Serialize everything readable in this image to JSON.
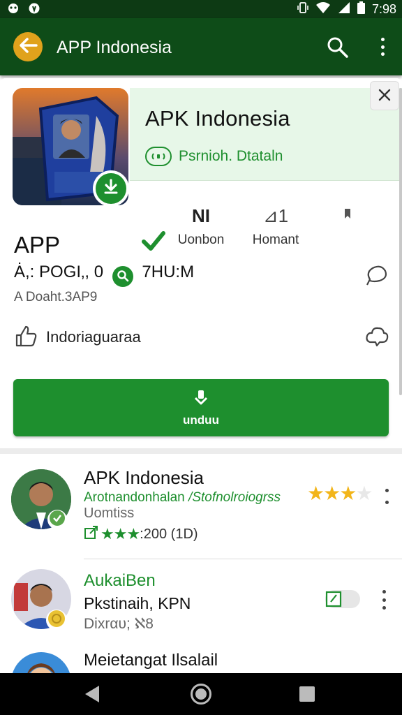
{
  "status_bar": {
    "time": "7:98",
    "left_icons": [
      "notification-icon",
      "whatsapp-icon"
    ],
    "right_icons": [
      "vibrate-icon",
      "wifi-icon",
      "signal-icon",
      "battery-icon"
    ]
  },
  "app_bar": {
    "title": "APP Indonesia"
  },
  "app": {
    "name": "APK Indonesia",
    "developer": "Psrnioh. Dtataln",
    "label": "APP",
    "meta_left": "Ȧ,: POGI‚, 0",
    "meta_right": "7HU:M",
    "sub": "A Doaht.3AP9",
    "like_label": "Indoriaguaraa"
  },
  "stats": [
    {
      "icon": "verified-icon",
      "big": "",
      "label": ""
    },
    {
      "icon": "",
      "big": "NI",
      "label": "Uonbon"
    },
    {
      "icon": "",
      "big": "⊿1",
      "label": "Homant"
    },
    {
      "icon": "bookmark-icon",
      "big": "",
      "label": ""
    }
  ],
  "download_button": {
    "label": "unduu"
  },
  "list": [
    {
      "title": "APK Indonesia",
      "sub1a": "Arotnandonhalan",
      "sub1b": "Stofnolroiogrss",
      "sub2": "Uomtiss",
      "rating_text": ":200 (1D)"
    },
    {
      "title": "AukaiBen",
      "sub1": "Pkstinaih, KPN",
      "sub2": "Dixrαυ; ℵ8"
    },
    {
      "title": "Meietangat Ilsalail"
    }
  ],
  "colors": {
    "primary": "#1e8f2e",
    "app_bar": "#0e4c18",
    "accent": "#e0a21c",
    "star": "#f2b51a"
  }
}
